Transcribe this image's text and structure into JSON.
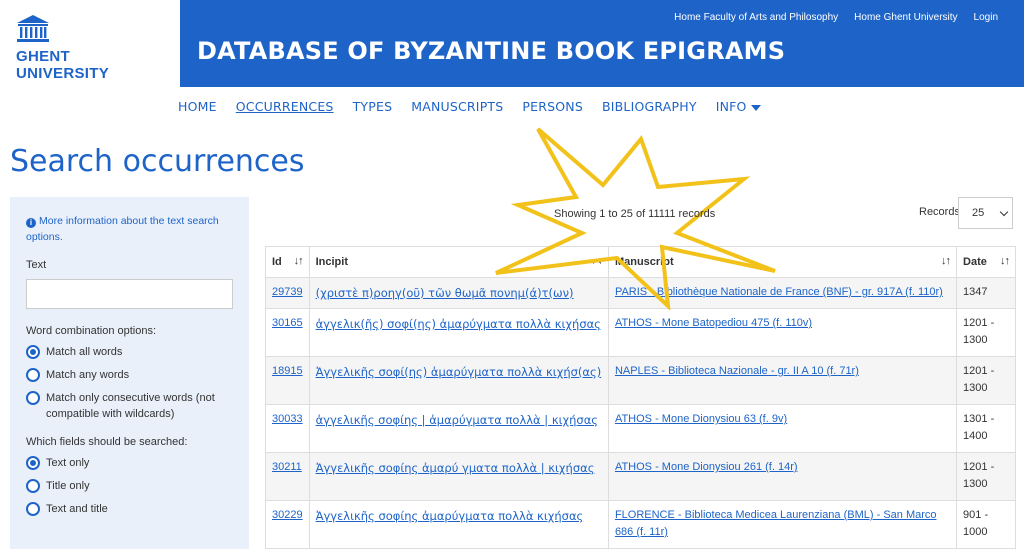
{
  "logo": {
    "line1": "GHENT",
    "line2": "UNIVERSITY"
  },
  "topnav": {
    "items": [
      "Home Faculty of Arts and Philosophy",
      "Home Ghent University",
      "Login"
    ]
  },
  "site_title": "DATABASE OF BYZANTINE BOOK EPIGRAMS",
  "mainnav": {
    "items": [
      "HOME",
      "OCCURRENCES",
      "TYPES",
      "MANUSCRIPTS",
      "PERSONS",
      "BIBLIOGRAPHY",
      "INFO"
    ],
    "active": "OCCURRENCES"
  },
  "page_title": "Search occurrences",
  "sidebar": {
    "info_text": "More information about the text search options.",
    "text_label": "Text",
    "text_value": "",
    "word_combination_label": "Word combination options:",
    "word_options": [
      {
        "label": "Match all words",
        "checked": true
      },
      {
        "label": "Match any words",
        "checked": false
      },
      {
        "label": "Match only consecutive words (not compatible with wildcards)",
        "checked": false
      }
    ],
    "fields_label": "Which fields should be searched:",
    "field_options": [
      {
        "label": "Text only",
        "checked": true
      },
      {
        "label": "Title only",
        "checked": false
      },
      {
        "label": "Text and title",
        "checked": false
      }
    ]
  },
  "records": {
    "showing_text": "Showing 1 to 25 of 11111 records",
    "label": "Records:",
    "per_page": "25"
  },
  "table": {
    "headers": {
      "id": "Id",
      "incipit": "Incipit",
      "manuscript": "Manuscript",
      "date": "Date",
      "sort_glyph": "↓↑"
    },
    "rows": [
      {
        "id": "29739",
        "incipit": "(χριστὲ π)ροηγ(οῦ) τῶν θωμᾶ πονημ(ά)τ(ων)",
        "manuscript": "PARIS - Bibliothèque Nationale de France (BNF) - gr. 917A (f. 110r)",
        "date": "1347"
      },
      {
        "id": "30165",
        "incipit": "ἀγγελικ(ῆς) σοφί(ης) ἀμαρύγματα πολλὰ κιχήσας",
        "manuscript": "ATHOS - Mone Batopediou 475 (f. 110v)",
        "date": "1201 - 1300"
      },
      {
        "id": "18915",
        "incipit": "Ἀγγελικῆς σοφί(ης) ἀμαρύγματα πολλὰ κιχήσ(ας)",
        "manuscript": "NAPLES - Biblioteca Nazionale - gr. II A 10 (f. 71r)",
        "date": "1201 - 1300"
      },
      {
        "id": "30033",
        "incipit": "ἀγγελικῆς σοφίης | ἀμαρύγματα πολλὰ | κιχήσας",
        "manuscript": "ATHOS - Mone Dionysiou 63 (f. 9v)",
        "date": "1301 - 1400"
      },
      {
        "id": "30211",
        "incipit": "Ἀγγελικῆς σοφίης ἀμαρύ γματα πολλὰ | κιχήσας",
        "manuscript": "ATHOS - Mone Dionysiou 261 (f. 14r)",
        "date": "1201 - 1300"
      },
      {
        "id": "30229",
        "incipit": "Ἀγγελικῆς σοφίης ἀμαρύγματα πολλὰ κιχήσας",
        "manuscript": "FLORENCE - Biblioteca Medicea Laurenziana (BML) - San Marco 686 (f. 11r)",
        "date": "901 - 1000"
      }
    ]
  },
  "colors": {
    "brand_blue": "#1e64c8",
    "sidebar_bg": "#e9f0fa",
    "burst_stroke": "#f2c21b"
  }
}
